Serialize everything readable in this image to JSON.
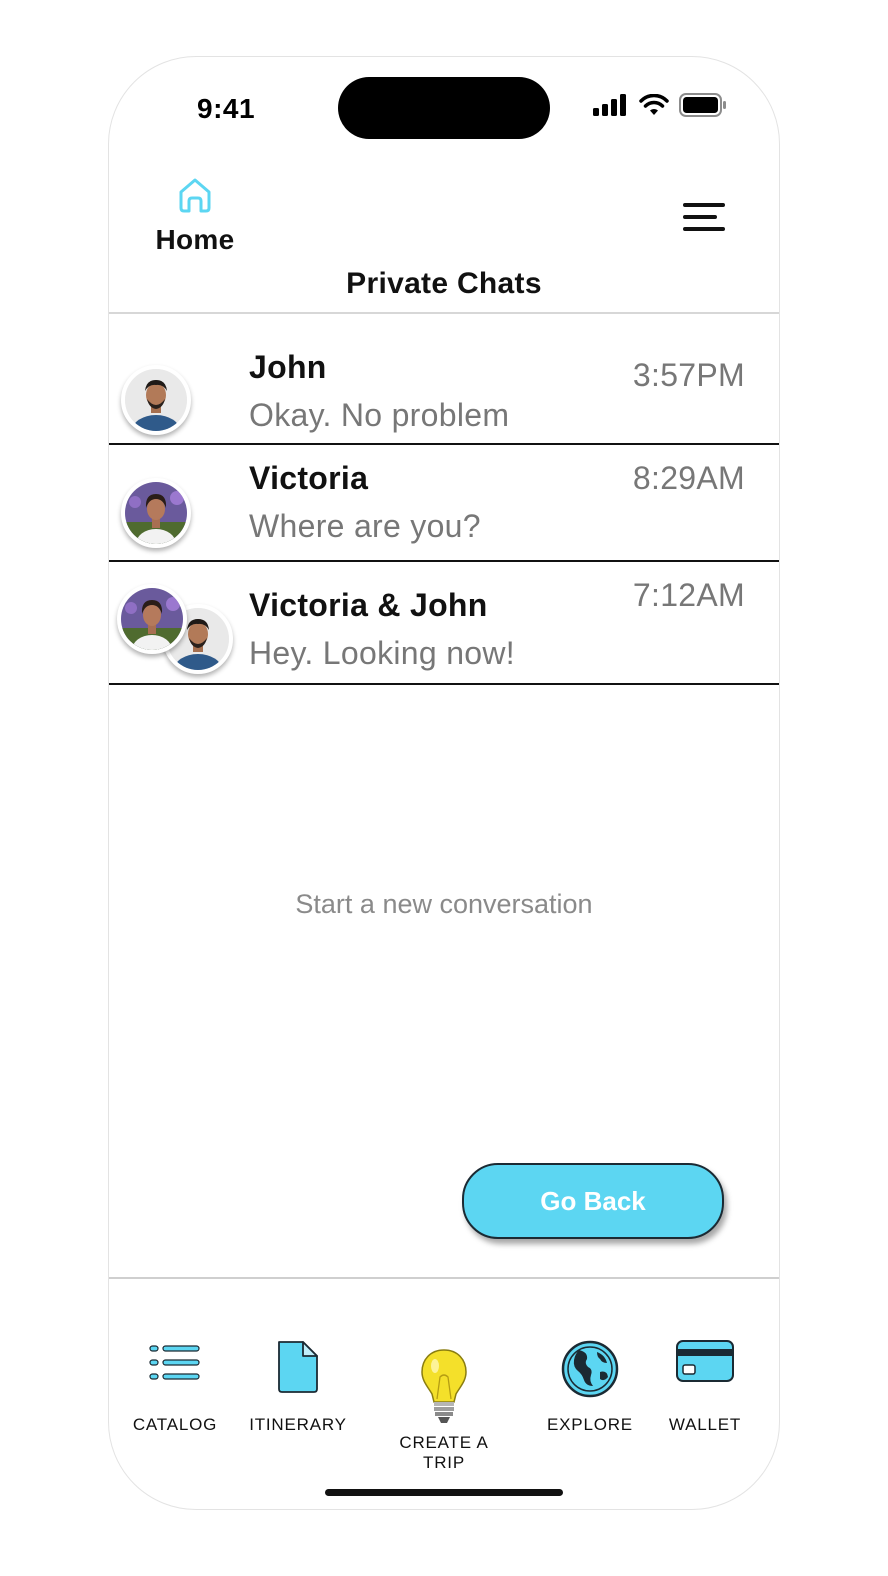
{
  "status": {
    "time": "9:41"
  },
  "header": {
    "home_label": "Home",
    "title": "Private Chats"
  },
  "chats": [
    {
      "name": "John",
      "message": "Okay. No problem",
      "time": "3:57PM"
    },
    {
      "name": "Victoria",
      "message": "Where are you?",
      "time": "8:29AM"
    },
    {
      "name": "Victoria & John",
      "message": "Hey. Looking now!",
      "time": "7:12AM"
    }
  ],
  "empty_state": "Start a new conversation",
  "go_back_label": "Go Back",
  "tabs": [
    {
      "label": "CATALOG",
      "icon": "list-icon"
    },
    {
      "label": "ITINERARY",
      "icon": "document-icon"
    },
    {
      "label": "CREATE A TRIP",
      "icon": "lightbulb-icon"
    },
    {
      "label": "EXPLORE",
      "icon": "globe-icon"
    },
    {
      "label": "WALLET",
      "icon": "credit-card-icon"
    }
  ],
  "colors": {
    "accent": "#5cd6f2",
    "text_primary": "#111111",
    "text_secondary": "#777777"
  }
}
